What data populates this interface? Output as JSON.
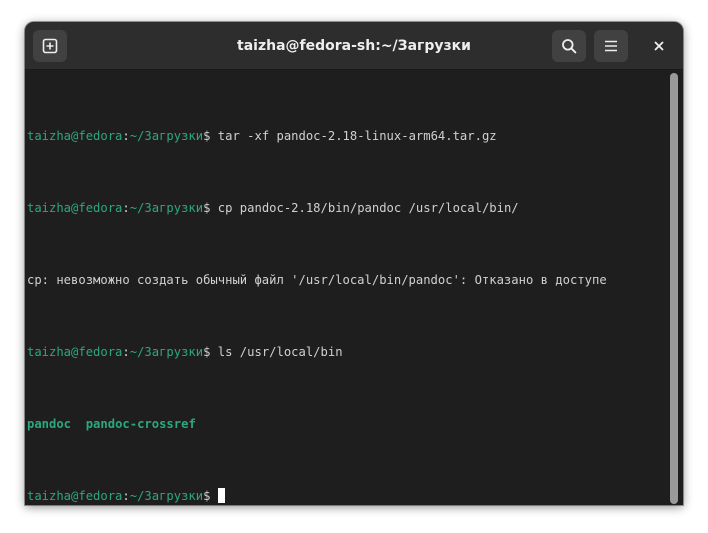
{
  "window": {
    "title": "taizha@fedora-sh:~/Загрузки"
  },
  "headerbar": {
    "new_tab_icon": "tab-new-icon",
    "search_icon": "search-icon",
    "menu_icon": "hamburger-menu-icon",
    "close_icon": "close-icon"
  },
  "colors": {
    "prompt_green": "#2ba87d",
    "background": "#1e1e1e",
    "headerbar": "#2d2d2d",
    "text": "#d0d0d0"
  },
  "prompt": {
    "user_host": "taizha@fedora",
    "separator": ":",
    "path": "~/Загрузки",
    "dollar": "$ "
  },
  "lines": [
    {
      "type": "command",
      "command": "tar -xf pandoc-2.18-linux-arm64.tar.gz"
    },
    {
      "type": "command",
      "command": "cp pandoc-2.18/bin/pandoc /usr/local/bin/"
    },
    {
      "type": "output",
      "text": "cp: невозможно создать обычный файл '/usr/local/bin/pandoc': Отказано в доступе"
    },
    {
      "type": "command",
      "command": "ls /usr/local/bin"
    },
    {
      "type": "listing",
      "items": [
        "pandoc",
        "pandoc-crossref"
      ]
    },
    {
      "type": "current_prompt",
      "command": ""
    }
  ]
}
